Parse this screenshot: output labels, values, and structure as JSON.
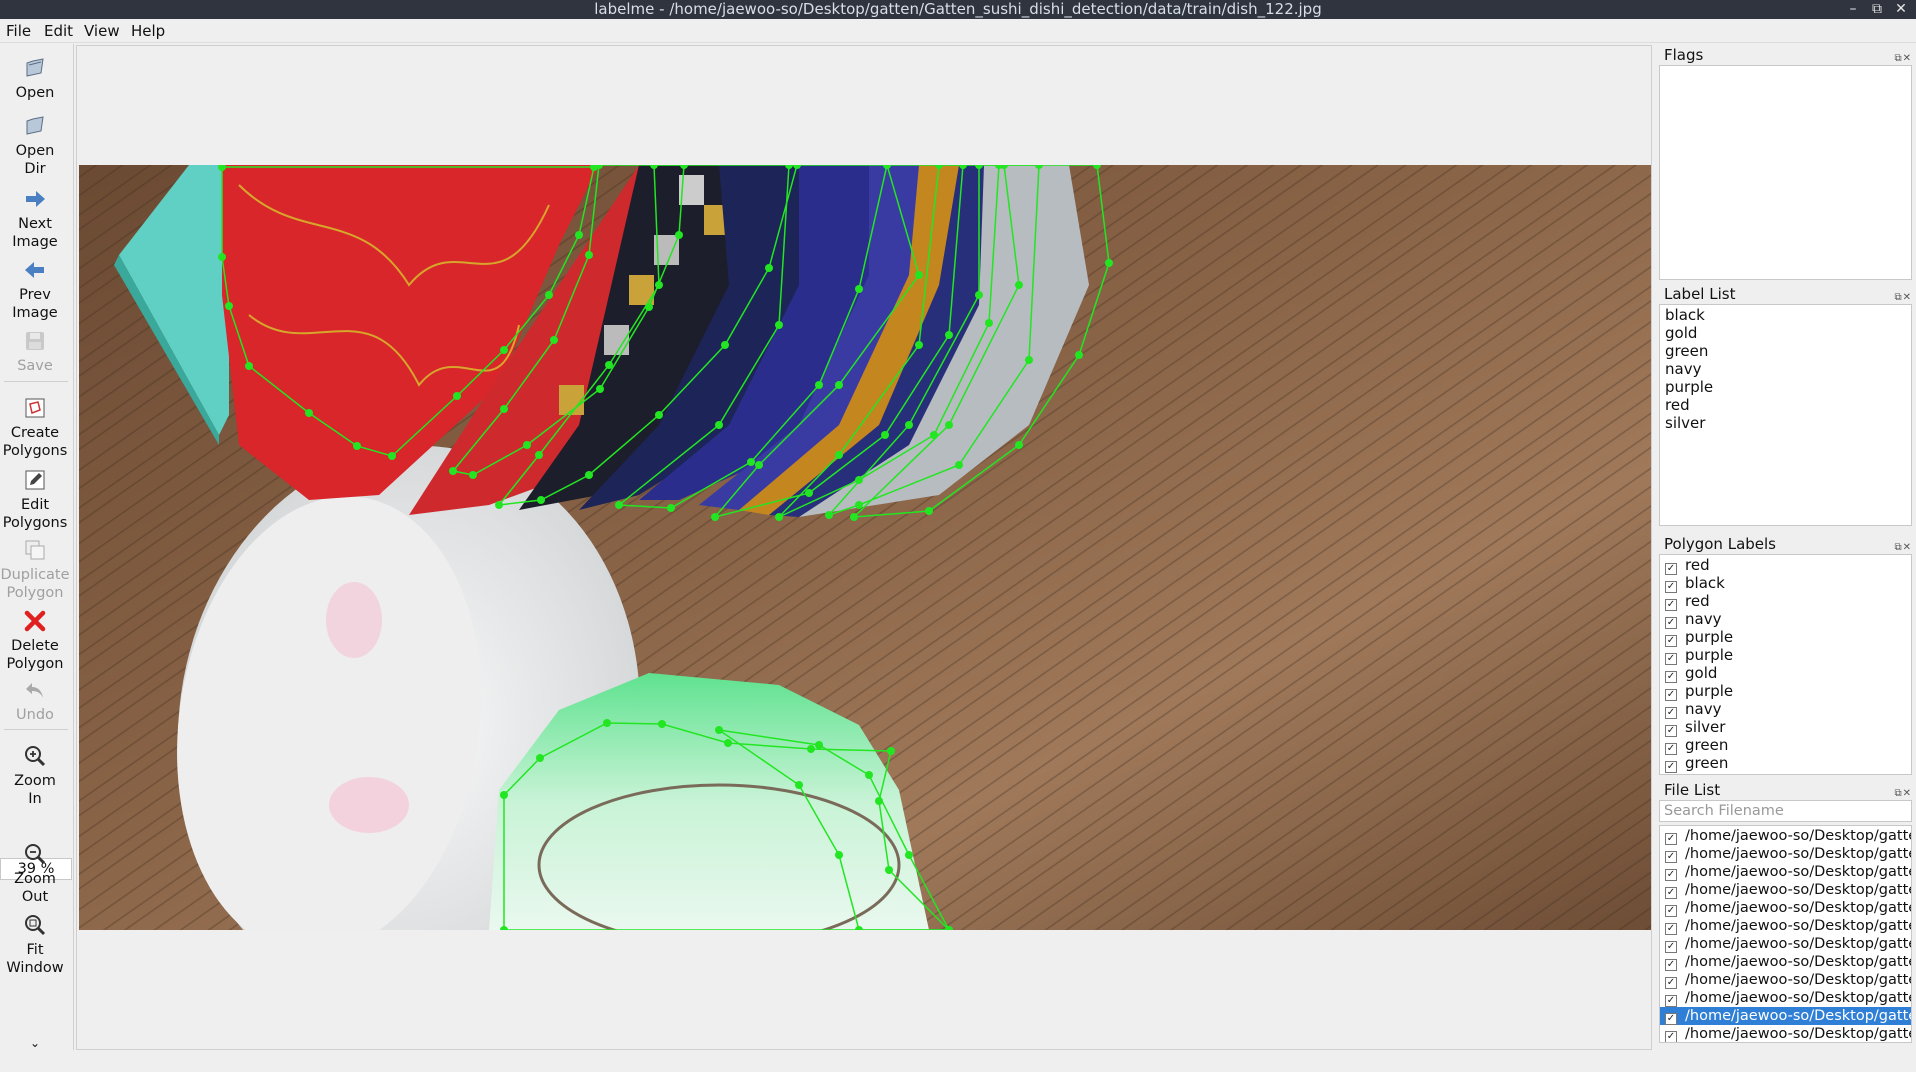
{
  "window": {
    "title": "labelme - /home/jaewoo-so/Desktop/gatten/Gatten_sushi_dishi_detection/data/train/dish_122.jpg",
    "controls": [
      "–",
      "⧉",
      "✕"
    ]
  },
  "menu": [
    "File",
    "Edit",
    "View",
    "Help"
  ],
  "toolbar": {
    "open": "Open",
    "open_dir_1": "Open",
    "open_dir_2": "Dir",
    "next_1": "Next",
    "next_2": "Image",
    "prev_1": "Prev",
    "prev_2": "Image",
    "save": "Save",
    "create_1": "Create",
    "create_2": "Polygons",
    "edit_1": "Edit",
    "edit_2": "Polygons",
    "dup_1": "Duplicate",
    "dup_2": "Polygon",
    "delete_1": "Delete",
    "delete_2": "Polygon",
    "undo": "Undo",
    "zoomin_1": "Zoom",
    "zoomin_2": "In",
    "zoom_value": "39 %",
    "zoomout_1": "Zoom",
    "zoomout_2": "Out",
    "fit_1": "Fit",
    "fit_2": "Window",
    "more": "⌄"
  },
  "docks": {
    "flags": {
      "title": "Flags"
    },
    "label_list": {
      "title": "Label List",
      "items": [
        "black",
        "gold",
        "green",
        "navy",
        "purple",
        "red",
        "silver"
      ]
    },
    "polygon_labels": {
      "title": "Polygon Labels",
      "items": [
        "red",
        "black",
        "red",
        "navy",
        "purple",
        "purple",
        "gold",
        "purple",
        "navy",
        "silver",
        "green",
        "green"
      ]
    },
    "file_list": {
      "title": "File List",
      "search_placeholder": "Search Filename",
      "items": [
        "/home/jaewoo-so/Desktop/gatte",
        "/home/jaewoo-so/Desktop/gatte",
        "/home/jaewoo-so/Desktop/gatte",
        "/home/jaewoo-so/Desktop/gatte",
        "/home/jaewoo-so/Desktop/gatte",
        "/home/jaewoo-so/Desktop/gatte",
        "/home/jaewoo-so/Desktop/gatte",
        "/home/jaewoo-so/Desktop/gatte",
        "/home/jaewoo-so/Desktop/gatte",
        "/home/jaewoo-so/Desktop/gatte",
        "/home/jaewoo-so/Desktop/gatte",
        "/home/jaewoo-so/Desktop/gatte"
      ],
      "selected_index": 10
    }
  },
  "colors": {
    "polygon": "#22e622",
    "selection": "#2f7fd6",
    "titlebar": "#2f343f"
  }
}
